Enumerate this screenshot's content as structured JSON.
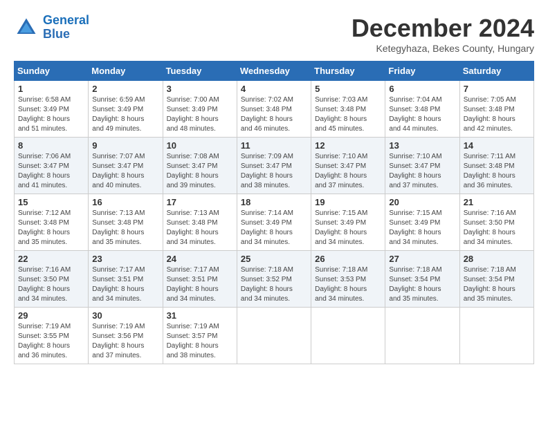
{
  "logo": {
    "line1": "General",
    "line2": "Blue"
  },
  "title": "December 2024",
  "subtitle": "Ketegyhaza, Bekes County, Hungary",
  "days_header": [
    "Sunday",
    "Monday",
    "Tuesday",
    "Wednesday",
    "Thursday",
    "Friday",
    "Saturday"
  ],
  "weeks": [
    [
      {
        "day": "1",
        "sunrise": "6:58 AM",
        "sunset": "3:49 PM",
        "daylight": "8 hours and 51 minutes."
      },
      {
        "day": "2",
        "sunrise": "6:59 AM",
        "sunset": "3:49 PM",
        "daylight": "8 hours and 49 minutes."
      },
      {
        "day": "3",
        "sunrise": "7:00 AM",
        "sunset": "3:49 PM",
        "daylight": "8 hours and 48 minutes."
      },
      {
        "day": "4",
        "sunrise": "7:02 AM",
        "sunset": "3:48 PM",
        "daylight": "8 hours and 46 minutes."
      },
      {
        "day": "5",
        "sunrise": "7:03 AM",
        "sunset": "3:48 PM",
        "daylight": "8 hours and 45 minutes."
      },
      {
        "day": "6",
        "sunrise": "7:04 AM",
        "sunset": "3:48 PM",
        "daylight": "8 hours and 44 minutes."
      },
      {
        "day": "7",
        "sunrise": "7:05 AM",
        "sunset": "3:48 PM",
        "daylight": "8 hours and 42 minutes."
      }
    ],
    [
      {
        "day": "8",
        "sunrise": "7:06 AM",
        "sunset": "3:47 PM",
        "daylight": "8 hours and 41 minutes."
      },
      {
        "day": "9",
        "sunrise": "7:07 AM",
        "sunset": "3:47 PM",
        "daylight": "8 hours and 40 minutes."
      },
      {
        "day": "10",
        "sunrise": "7:08 AM",
        "sunset": "3:47 PM",
        "daylight": "8 hours and 39 minutes."
      },
      {
        "day": "11",
        "sunrise": "7:09 AM",
        "sunset": "3:47 PM",
        "daylight": "8 hours and 38 minutes."
      },
      {
        "day": "12",
        "sunrise": "7:10 AM",
        "sunset": "3:47 PM",
        "daylight": "8 hours and 37 minutes."
      },
      {
        "day": "13",
        "sunrise": "7:10 AM",
        "sunset": "3:47 PM",
        "daylight": "8 hours and 37 minutes."
      },
      {
        "day": "14",
        "sunrise": "7:11 AM",
        "sunset": "3:48 PM",
        "daylight": "8 hours and 36 minutes."
      }
    ],
    [
      {
        "day": "15",
        "sunrise": "7:12 AM",
        "sunset": "3:48 PM",
        "daylight": "8 hours and 35 minutes."
      },
      {
        "day": "16",
        "sunrise": "7:13 AM",
        "sunset": "3:48 PM",
        "daylight": "8 hours and 35 minutes."
      },
      {
        "day": "17",
        "sunrise": "7:13 AM",
        "sunset": "3:48 PM",
        "daylight": "8 hours and 34 minutes."
      },
      {
        "day": "18",
        "sunrise": "7:14 AM",
        "sunset": "3:49 PM",
        "daylight": "8 hours and 34 minutes."
      },
      {
        "day": "19",
        "sunrise": "7:15 AM",
        "sunset": "3:49 PM",
        "daylight": "8 hours and 34 minutes."
      },
      {
        "day": "20",
        "sunrise": "7:15 AM",
        "sunset": "3:49 PM",
        "daylight": "8 hours and 34 minutes."
      },
      {
        "day": "21",
        "sunrise": "7:16 AM",
        "sunset": "3:50 PM",
        "daylight": "8 hours and 34 minutes."
      }
    ],
    [
      {
        "day": "22",
        "sunrise": "7:16 AM",
        "sunset": "3:50 PM",
        "daylight": "8 hours and 34 minutes."
      },
      {
        "day": "23",
        "sunrise": "7:17 AM",
        "sunset": "3:51 PM",
        "daylight": "8 hours and 34 minutes."
      },
      {
        "day": "24",
        "sunrise": "7:17 AM",
        "sunset": "3:51 PM",
        "daylight": "8 hours and 34 minutes."
      },
      {
        "day": "25",
        "sunrise": "7:18 AM",
        "sunset": "3:52 PM",
        "daylight": "8 hours and 34 minutes."
      },
      {
        "day": "26",
        "sunrise": "7:18 AM",
        "sunset": "3:53 PM",
        "daylight": "8 hours and 34 minutes."
      },
      {
        "day": "27",
        "sunrise": "7:18 AM",
        "sunset": "3:54 PM",
        "daylight": "8 hours and 35 minutes."
      },
      {
        "day": "28",
        "sunrise": "7:18 AM",
        "sunset": "3:54 PM",
        "daylight": "8 hours and 35 minutes."
      }
    ],
    [
      {
        "day": "29",
        "sunrise": "7:19 AM",
        "sunset": "3:55 PM",
        "daylight": "8 hours and 36 minutes."
      },
      {
        "day": "30",
        "sunrise": "7:19 AM",
        "sunset": "3:56 PM",
        "daylight": "8 hours and 37 minutes."
      },
      {
        "day": "31",
        "sunrise": "7:19 AM",
        "sunset": "3:57 PM",
        "daylight": "8 hours and 38 minutes."
      },
      null,
      null,
      null,
      null
    ]
  ]
}
